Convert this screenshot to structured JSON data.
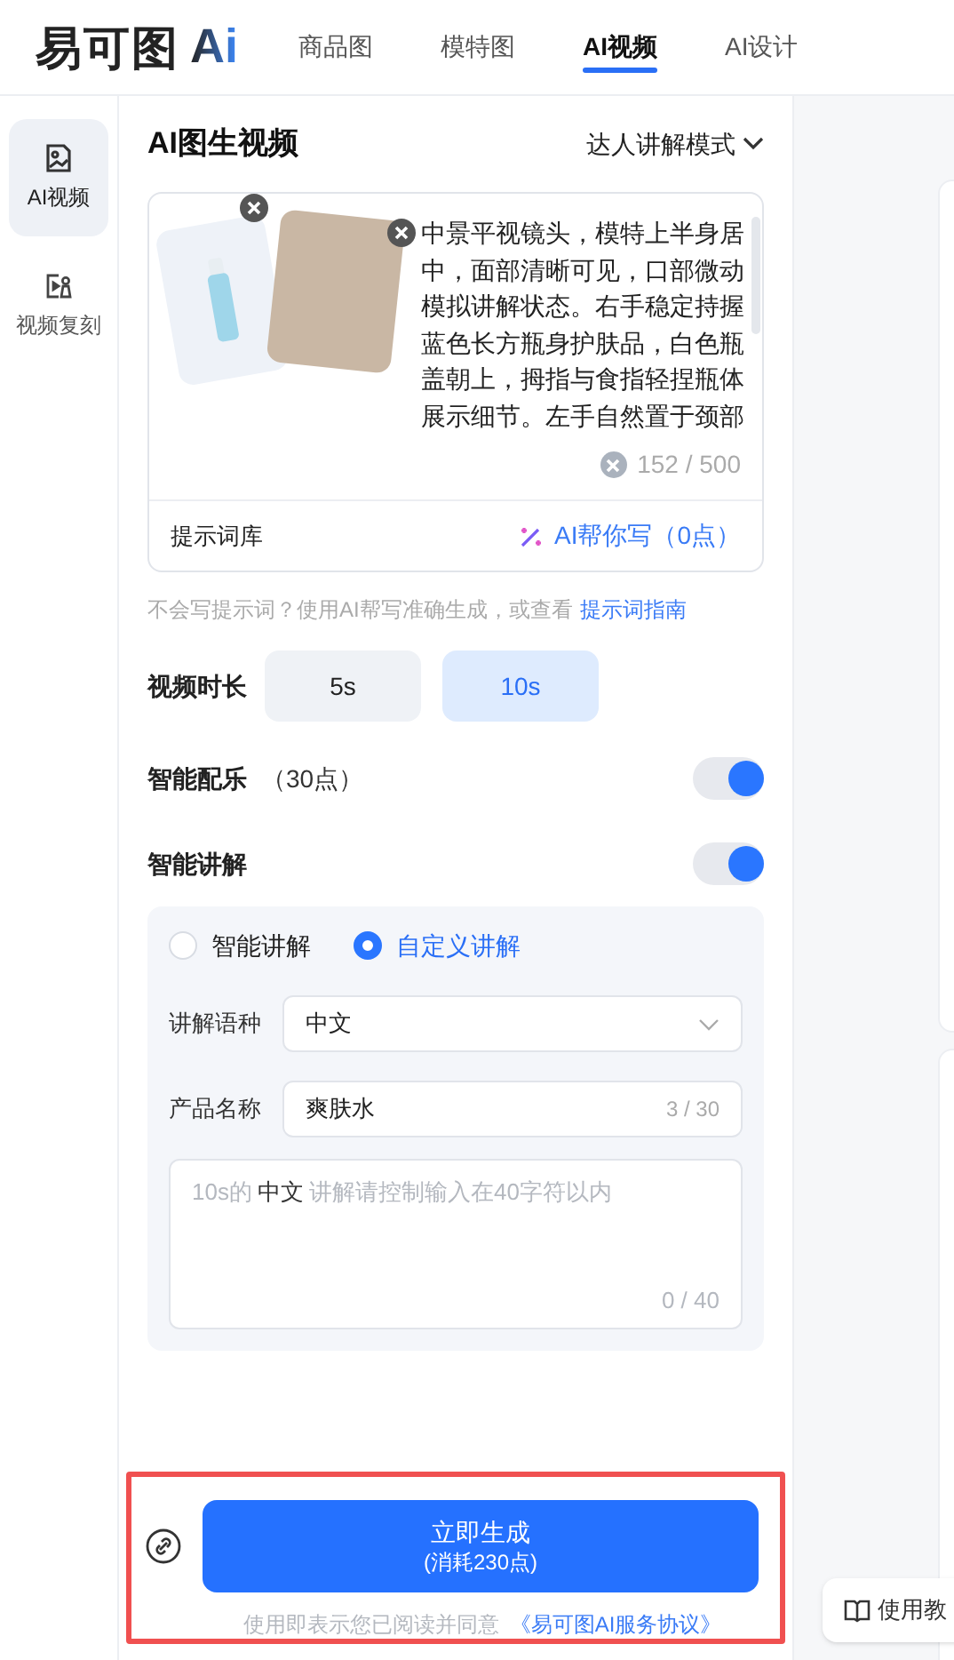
{
  "header": {
    "logo": {
      "text": "易可图",
      "mark": "Ai"
    },
    "tabs": [
      {
        "label": "商品图",
        "selected": false
      },
      {
        "label": "模特图",
        "selected": false
      },
      {
        "label": "AI视频",
        "selected": true
      },
      {
        "label": "AI设计",
        "selected": false
      }
    ]
  },
  "sidebar": {
    "items": [
      {
        "label": "AI视频",
        "kind": "image",
        "selected": true
      },
      {
        "label": "视频复刻",
        "kind": "replicate",
        "selected": false
      }
    ]
  },
  "panel": {
    "title": "AI图生视频",
    "mode": "达人讲解模式",
    "prompt": {
      "text": "中景平视镜头，模特上半身居中，面部清晰可见，口部微动模拟讲解状态。右手稳定持握蓝色长方瓶身护肤品，白色瓶盖朝上，拇指与食指轻捏瓶体展示细节。左手自然置于颈部",
      "counter": "152 / 500",
      "library": "提示词库",
      "ai_write": "AI帮你写（0点）"
    },
    "hint": {
      "text": "不会写提示词？使用AI帮写准确生成，或查看",
      "link": "提示词指南"
    },
    "duration": {
      "label": "视频时长",
      "options": [
        {
          "label": "5s",
          "selected": false
        },
        {
          "label": "10s",
          "selected": true
        }
      ]
    },
    "music": {
      "label": "智能配乐",
      "cost": "（30点）",
      "on": true
    },
    "narration": {
      "label": "智能讲解",
      "on": true,
      "modes": [
        {
          "label": "智能讲解",
          "selected": false
        },
        {
          "label": "自定义讲解",
          "selected": true
        }
      ],
      "language": {
        "label": "讲解语种",
        "value": "中文"
      },
      "product_name": {
        "label": "产品名称",
        "value": "爽肤水",
        "counter": "3 / 30"
      },
      "script": {
        "placeholder": [
          {
            "text": "10s的",
            "kind": "hint"
          },
          {
            "text": "中文",
            "kind": "emphasis"
          },
          {
            "text": "讲解请控制输入在40字符以内",
            "kind": "hint"
          }
        ],
        "counter": "0 / 40"
      }
    },
    "generate": {
      "title": "立即生成",
      "subtitle": "(消耗230点)",
      "agreement": "使用即表示您已阅读并同意",
      "link": "《易可图AI服务协议》"
    }
  },
  "tutorial_button": "使用教"
}
